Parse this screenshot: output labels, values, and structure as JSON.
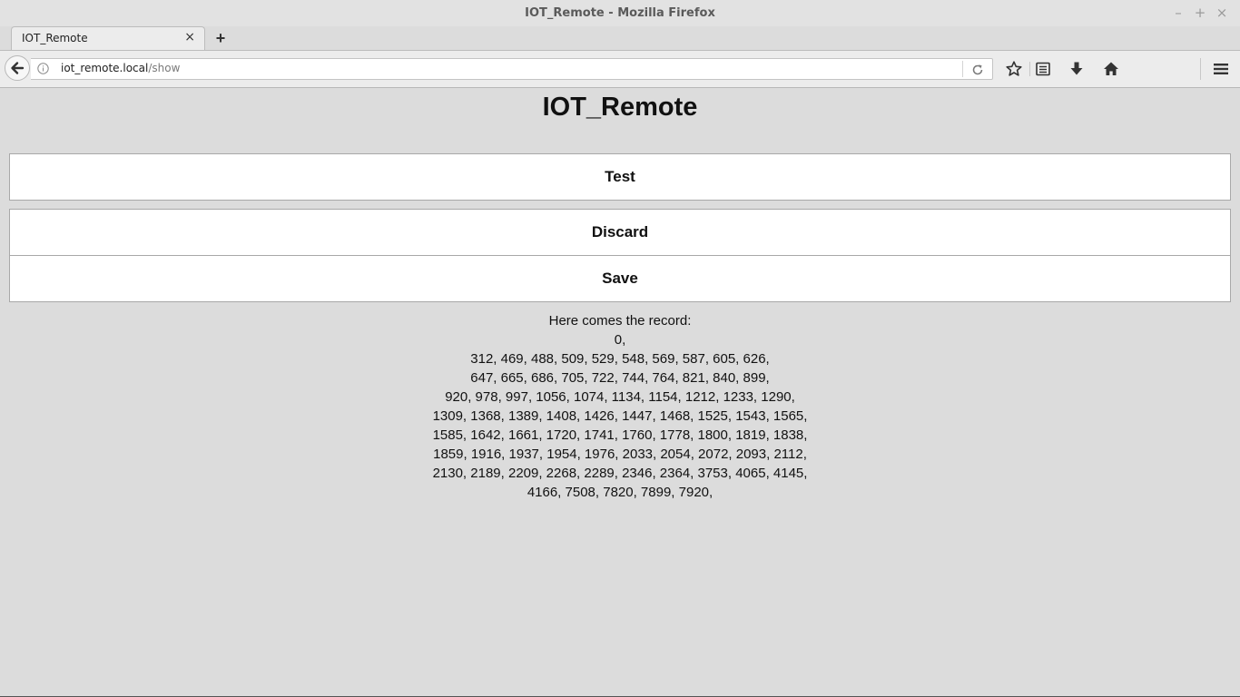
{
  "window": {
    "title": "IOT_Remote - Mozilla Firefox",
    "controls": [
      "–",
      "+",
      "×"
    ]
  },
  "tabs": [
    {
      "label": "IOT_Remote",
      "close": "×"
    }
  ],
  "new_tab": "+",
  "urlbar": {
    "host": "iot_remote.local",
    "path": "/show"
  },
  "icons": {
    "back": "back-arrow-icon",
    "info": "info-icon",
    "reload": "reload-icon",
    "bookmark": "star-icon",
    "reader": "reading-list-icon",
    "downloads": "download-icon",
    "home": "home-icon",
    "menu": "hamburger-menu-icon"
  },
  "page": {
    "heading": "IOT_Remote",
    "buttons": {
      "test": "Test",
      "discard": "Discard",
      "save": "Save"
    },
    "record": {
      "intro": "Here comes the record:",
      "lines": [
        "0,",
        "312, 469, 488, 509, 529, 548, 569, 587, 605, 626,",
        "647, 665, 686, 705, 722, 744, 764, 821, 840, 899,",
        "920, 978, 997, 1056, 1074, 1134, 1154, 1212, 1233, 1290,",
        "1309, 1368, 1389, 1408, 1426, 1447, 1468, 1525, 1543, 1565,",
        "1585, 1642, 1661, 1720, 1741, 1760, 1778, 1800, 1819, 1838,",
        "1859, 1916, 1937, 1954, 1976, 2033, 2054, 2072, 2093, 2112,",
        "2130, 2189, 2209, 2268, 2289, 2346, 2364, 3753, 4065, 4145,",
        "4166, 7508, 7820, 7899, 7920,"
      ]
    }
  },
  "colors": {
    "page_background": "#dcdcdc",
    "button_background": "#ffffff",
    "button_border": "#a8a8a8",
    "text": "#111111"
  }
}
